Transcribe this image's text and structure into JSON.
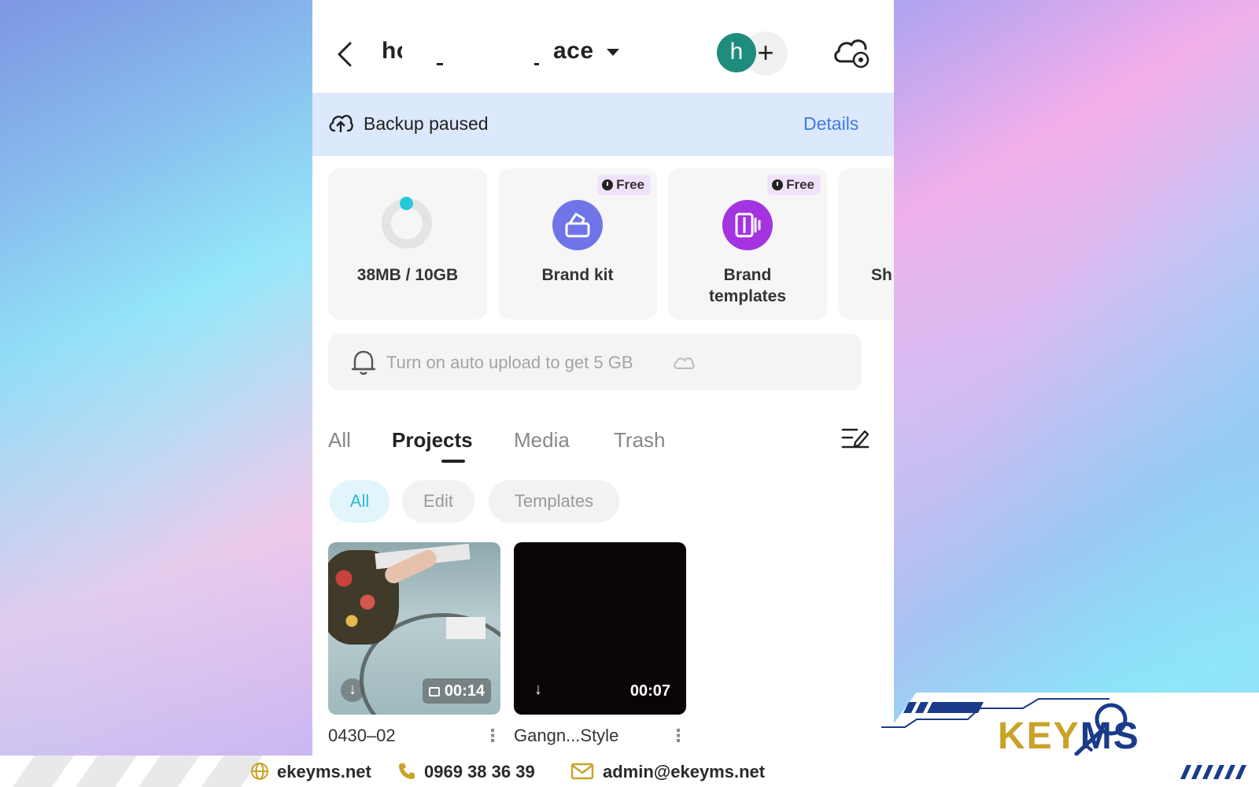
{
  "header": {
    "workspace_name": "hc",
    "workspace_suffix": "ace",
    "avatar_letter": "h",
    "add_label": "+"
  },
  "backup": {
    "status": "Backup paused",
    "details_label": "Details"
  },
  "cards": [
    {
      "label": "38MB / 10GB",
      "icon": "storage-donut-icon"
    },
    {
      "label": "Brand kit",
      "badge": "Free",
      "icon": "brand-kit-icon",
      "color": "#6f75e8"
    },
    {
      "label": "Brand\ntemplates",
      "badge": "Free",
      "icon": "brand-templates-icon",
      "color": "#a334e0"
    },
    {
      "label": "Sh",
      "icon": "unknown"
    }
  ],
  "storage": {
    "used": "38MB",
    "total": "10GB"
  },
  "upload_prompt": "Turn on auto upload to get 5 GB",
  "tabs": [
    {
      "label": "All"
    },
    {
      "label": "Projects",
      "active": true
    },
    {
      "label": "Media"
    },
    {
      "label": "Trash"
    }
  ],
  "chips": [
    {
      "label": "All",
      "active": true
    },
    {
      "label": "Edit"
    },
    {
      "label": "Templates"
    }
  ],
  "projects": [
    {
      "name": "0430–02",
      "duration": "00:14",
      "more": "⋮"
    },
    {
      "name": "Gangn...Style",
      "duration": "00:07",
      "more": "⋮"
    }
  ],
  "footer": {
    "website": "ekeyms.net",
    "phone": "0969 38 36 39",
    "email": "admin@ekeyms.net",
    "logo_main": "KEY",
    "logo_ms": "MS"
  },
  "colors": {
    "accent_blue": "#3f7be3",
    "teal_avatar": "#1e8d7e",
    "chip_active": "#2bbad4",
    "brand_gold": "#c9a227",
    "brand_navy": "#1a3b8a"
  }
}
